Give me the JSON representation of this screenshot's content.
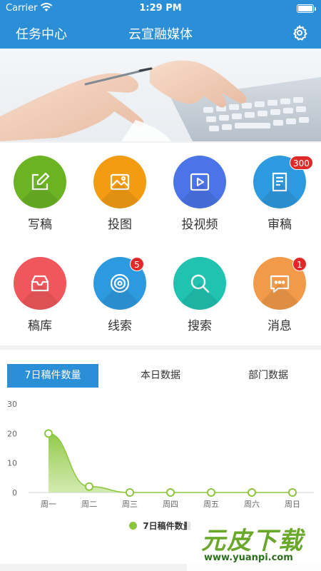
{
  "status": {
    "carrier": "Carrier",
    "time": "1:29 PM"
  },
  "nav": {
    "left": "任务中心",
    "title": "云宣融媒体",
    "settings_icon": "gear-icon"
  },
  "colors": {
    "primary": "#2a8fd6",
    "green": "#8cc63f",
    "badge": "#e02a2a"
  },
  "tiles": [
    {
      "label": "写稿",
      "icon": "edit-icon",
      "color": "#6cb324",
      "badge": ""
    },
    {
      "label": "投图",
      "icon": "image-icon",
      "color": "#f39c12",
      "badge": ""
    },
    {
      "label": "投视频",
      "icon": "video-icon",
      "color": "#4a74e8",
      "badge": ""
    },
    {
      "label": "审稿",
      "icon": "document-icon",
      "color": "#2d9ae0",
      "badge": "300"
    },
    {
      "label": "稿库",
      "icon": "inbox-icon",
      "color": "#f0575c",
      "badge": ""
    },
    {
      "label": "线索",
      "icon": "target-icon",
      "color": "#2d9ae0",
      "badge": "5"
    },
    {
      "label": "搜索",
      "icon": "search-icon",
      "color": "#21c2b0",
      "badge": ""
    },
    {
      "label": "消息",
      "icon": "message-icon",
      "color": "#f39a4a",
      "badge": "1"
    }
  ],
  "tabs": [
    "7日稿件数量",
    "本日数据",
    "部门数据"
  ],
  "chart_data": {
    "type": "area",
    "categories": [
      "周一",
      "周二",
      "周三",
      "周四",
      "周五",
      "周六",
      "周日"
    ],
    "series": [
      {
        "name": "7日稿件数量",
        "values": [
          20,
          2,
          0,
          0,
          0,
          0,
          0
        ]
      }
    ],
    "yticks": [
      "0",
      "10",
      "20",
      "30"
    ],
    "ylim": [
      0,
      30
    ],
    "legend_position": "bottom",
    "grid": false
  },
  "watermark": {
    "main": "元皮下载",
    "sub": "www.yuanpi.com"
  }
}
